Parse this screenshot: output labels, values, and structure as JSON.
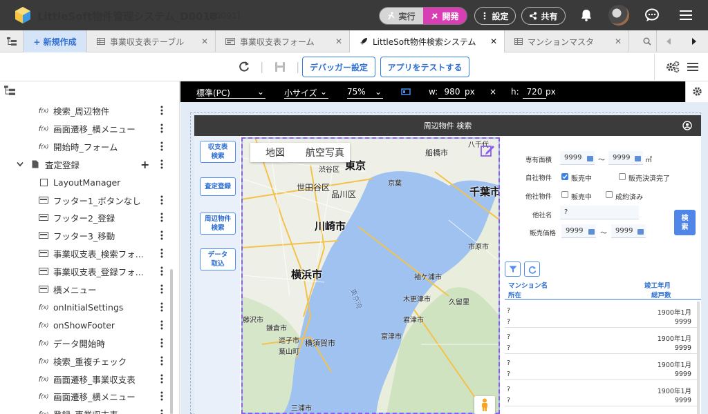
{
  "header": {
    "title": "LittleSoft物件管理システム_D0018",
    "app_id": "[D0091]",
    "run_label": "実行",
    "dev_label": "開発",
    "settings_label": "設定",
    "share_label": "共有"
  },
  "tabs": {
    "new_label": "+ 新規作成",
    "items": [
      {
        "label": "事業収支表テーブル"
      },
      {
        "label": "事業収支表フォーム"
      },
      {
        "label": "LittleSoft物件検索システム"
      },
      {
        "label": "マンションマスタ"
      }
    ]
  },
  "toolbar": {
    "debug_label": "デバッガー設定",
    "test_label": "アプリをテストする"
  },
  "tree": {
    "items": [
      {
        "icon": "f(x)",
        "label": "検索_周辺物件"
      },
      {
        "icon": "f(x)",
        "label": "画面遷移_横メニュー"
      },
      {
        "icon": "f(x)",
        "label": "開始時_フォーム"
      },
      {
        "icon": "page",
        "label": "査定登録"
      },
      {
        "icon": "box",
        "label": "LayoutManager"
      },
      {
        "icon": "bar",
        "label": "フッター1_ボタンなし"
      },
      {
        "icon": "bar",
        "label": "フッター2_登録"
      },
      {
        "icon": "bar",
        "label": "フッター3_移動"
      },
      {
        "icon": "bar",
        "label": "事業収支表_検索フォ..."
      },
      {
        "icon": "bar",
        "label": "事業収支表_登録フォ..."
      },
      {
        "icon": "bar",
        "label": "横メニュー"
      },
      {
        "icon": "f(x)",
        "label": "onInitialSettings"
      },
      {
        "icon": "f(x)",
        "label": "onShowFooter"
      },
      {
        "icon": "f(x)",
        "label": "データ開始時"
      },
      {
        "icon": "f(x)",
        "label": "検索_重複チェック"
      },
      {
        "icon": "f(x)",
        "label": "画面遷移_事業収支表"
      },
      {
        "icon": "f(x)",
        "label": "画面遷移_横メニュー"
      },
      {
        "icon": "f(x)",
        "label": "登録_事業収支表"
      }
    ]
  },
  "device_bar": {
    "device": "標準(PC)",
    "size": "小サイズ",
    "zoom": "75%",
    "w_label": "w:",
    "w_value": "980",
    "h_label": "h:",
    "h_value": "720",
    "unit": "px",
    "times": "×"
  },
  "preview": {
    "page_title": "周辺物件 検索",
    "nav_buttons": [
      "収支表\n検索",
      "査定登録",
      "周辺物件\n検索",
      "データ\n取込"
    ],
    "map": {
      "tab_map": "地図",
      "tab_aerial": "航空写真",
      "labels_big": [
        "東京",
        "渋谷区",
        "世田谷区",
        "品川区",
        "川崎市",
        "横浜市",
        "千葉市"
      ],
      "labels_small": [
        "八千代",
        "船橋市",
        "京葉",
        "市原市",
        "袖ケ浦市",
        "木更津市",
        "久留里",
        "君津市",
        "富津市",
        "横須賀市",
        "逗子市",
        "鎌倉市",
        "葉山町",
        "藤沢市",
        "三浦市",
        "東京湾"
      ]
    },
    "form": {
      "area_label": "専有面積",
      "area_from": "9999",
      "area_to": "9999",
      "tilde": "〜",
      "area_unit": "㎡",
      "own_label": "自社物件",
      "own_opt1": "販売中",
      "own_opt2": "販売決済完了",
      "other_label": "他社物件",
      "other_opt1": "販売中",
      "other_opt2": "成約済み",
      "company_label": "他社名",
      "company_value": "?",
      "price_label": "販売価格",
      "price_from": "9999",
      "price_to": "9999",
      "search_label": "検\n索"
    },
    "list": {
      "col1": "マンション名",
      "col2": "所在",
      "col3": "竣工年月",
      "col4": "総戸数",
      "rows": [
        {
          "name": "?",
          "addr": "?",
          "date": "1900年1月",
          "units": "9999"
        },
        {
          "name": "?",
          "addr": "?",
          "date": "1900年1月",
          "units": "9999"
        },
        {
          "name": "?",
          "addr": "?",
          "date": "1900年1月",
          "units": "9999"
        },
        {
          "name": "?",
          "addr": "?",
          "date": "1900年1月",
          "units": "9999"
        }
      ]
    }
  },
  "colors": {
    "header_bg": "#3a3a3a",
    "dev_accent": "#d93fb5",
    "primary": "#2f6fd1"
  }
}
